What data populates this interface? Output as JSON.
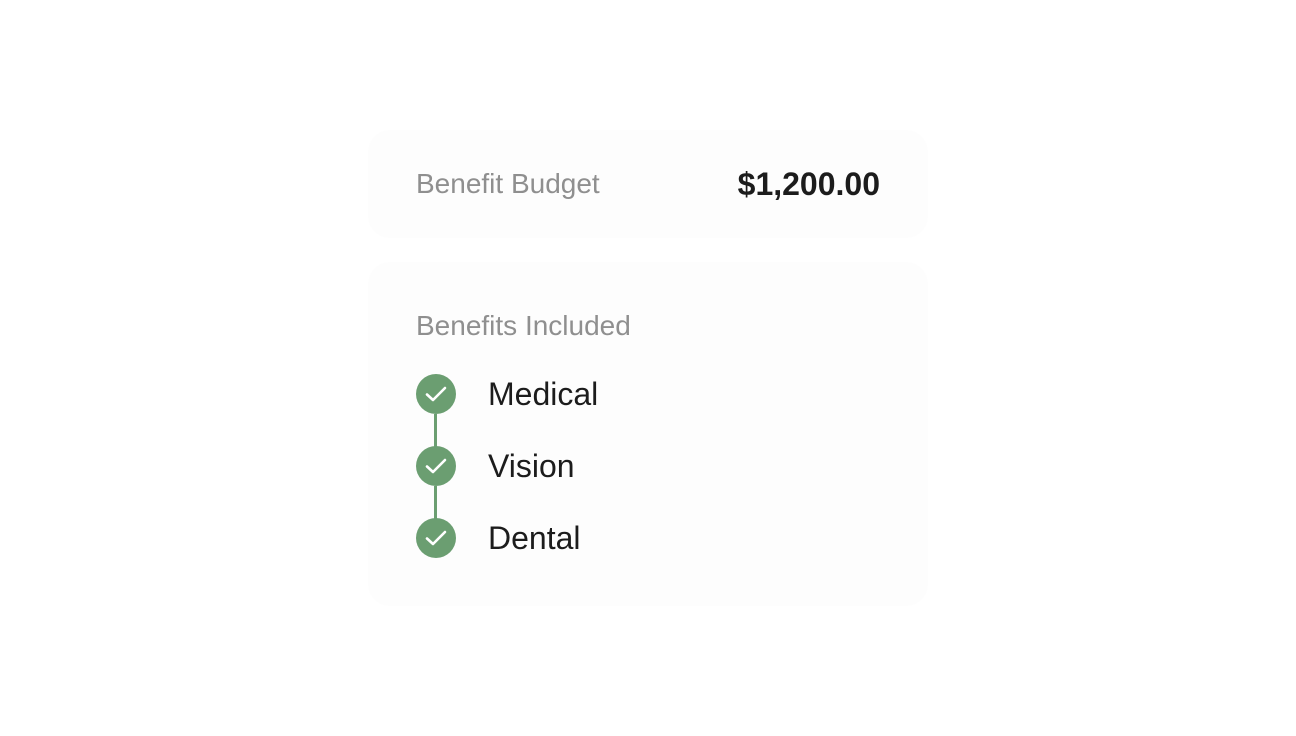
{
  "budget": {
    "label": "Benefit Budget",
    "amount": "$1,200.00"
  },
  "benefits": {
    "title": "Benefits Included",
    "items": [
      {
        "label": "Medical",
        "icon": "check-icon",
        "checked": true
      },
      {
        "label": "Vision",
        "icon": "check-icon",
        "checked": true
      },
      {
        "label": "Dental",
        "icon": "check-icon",
        "checked": true
      }
    ],
    "accent_color": "#6b9e71"
  }
}
